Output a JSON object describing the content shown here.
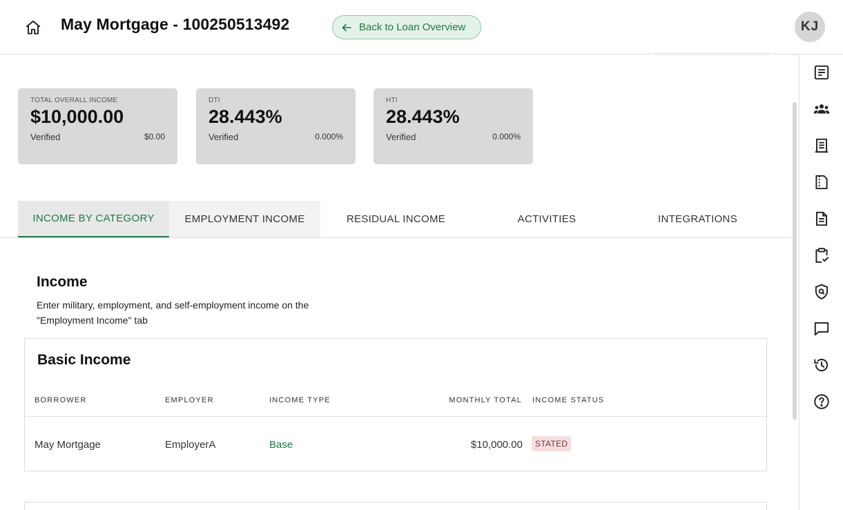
{
  "header": {
    "title": "May Mortgage - 100250513492",
    "back_label": "Back to Loan Overview",
    "avatar_initials": "KJ"
  },
  "metrics": [
    {
      "label": "TOTAL OVERALL INCOME",
      "value": "$10,000.00",
      "sub_label": "Verified",
      "sub_value": "$0.00"
    },
    {
      "label": "DTI",
      "value": "28.443%",
      "sub_label": "Verified",
      "sub_value": "0.000%"
    },
    {
      "label": "HTI",
      "value": "28.443%",
      "sub_label": "Verified",
      "sub_value": "0.000%"
    }
  ],
  "tabs": [
    {
      "label": "INCOME BY CATEGORY",
      "active": true
    },
    {
      "label": "EMPLOYMENT INCOME",
      "active": false
    },
    {
      "label": "RESIDUAL INCOME",
      "active": false
    },
    {
      "label": "ACTIVITIES",
      "active": false
    },
    {
      "label": "INTEGRATIONS",
      "active": false
    }
  ],
  "income": {
    "title": "Income",
    "description": "Enter military, employment, and self-employment income on the \"Employment Income\" tab"
  },
  "basic_income": {
    "title": "Basic Income",
    "columns": [
      "BORROWER",
      "EMPLOYER",
      "INCOME TYPE",
      "MONTHLY TOTAL",
      "INCOME STATUS"
    ],
    "rows": [
      {
        "borrower": "May Mortgage",
        "employer": "EmployerA",
        "income_type": "Base",
        "monthly_total": "$10,000.00",
        "status": "STATED"
      }
    ]
  },
  "sidebar_icons": [
    "notes-icon",
    "people-icon",
    "receipt-icon",
    "document-split-icon",
    "document-icon",
    "clipboard-check-icon",
    "shield-search-icon",
    "chat-icon",
    "history-icon",
    "help-icon"
  ],
  "colors": {
    "accent": "#1d7a45",
    "card_bg": "#d9d9d9",
    "badge_bg": "#f7dede"
  }
}
